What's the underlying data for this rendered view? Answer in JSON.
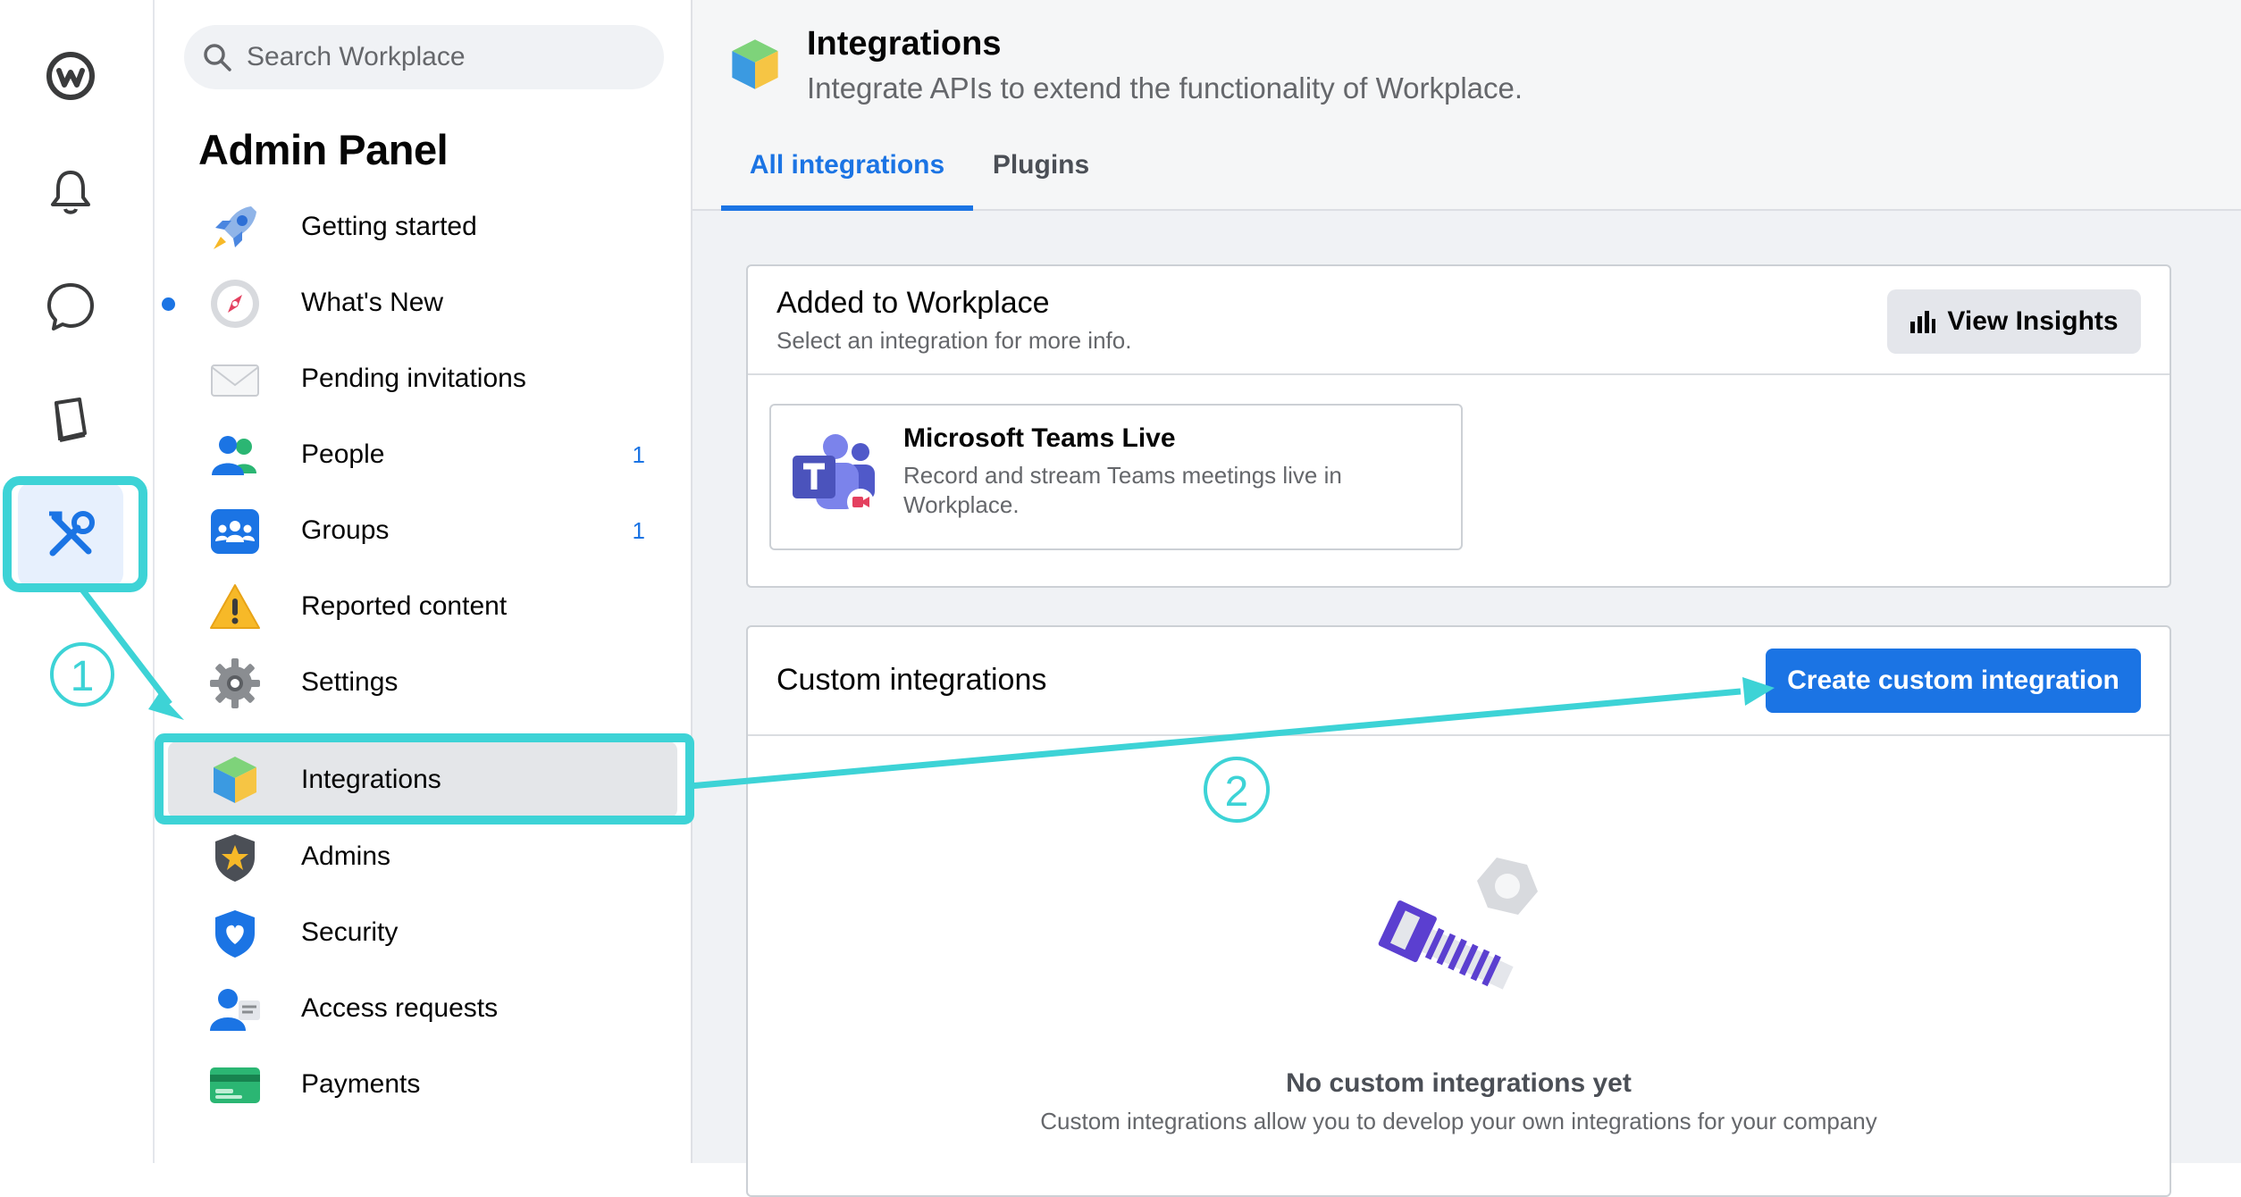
{
  "rail": {
    "items": [
      {
        "icon": "workplace-logo-icon"
      },
      {
        "icon": "bell-icon"
      },
      {
        "icon": "chat-bubble-icon"
      },
      {
        "icon": "book-icon"
      },
      {
        "icon": "tools-icon",
        "active": true
      }
    ]
  },
  "sidebar": {
    "search_placeholder": "Search Workplace",
    "title": "Admin Panel",
    "items": [
      {
        "label": "Getting started",
        "icon": "rocket-icon",
        "count": ""
      },
      {
        "label": "What's New",
        "icon": "compass-icon",
        "count": "",
        "unread_dot": true
      },
      {
        "label": "Pending invitations",
        "icon": "envelope-icon",
        "count": ""
      },
      {
        "label": "People",
        "icon": "people-icon",
        "count": "1"
      },
      {
        "label": "Groups",
        "icon": "groups-icon",
        "count": "1"
      },
      {
        "label": "Reported content",
        "icon": "warning-icon",
        "count": ""
      },
      {
        "label": "Settings",
        "icon": "gear-icon",
        "count": ""
      },
      {
        "label": "Integrations",
        "icon": "cube-icon",
        "count": "",
        "active": true
      },
      {
        "label": "Admins",
        "icon": "shield-star-icon",
        "count": ""
      },
      {
        "label": "Security",
        "icon": "shield-heart-icon",
        "count": ""
      },
      {
        "label": "Access requests",
        "icon": "person-request-icon",
        "count": ""
      },
      {
        "label": "Payments",
        "icon": "credit-card-icon",
        "count": ""
      }
    ]
  },
  "header": {
    "title": "Integrations",
    "subtitle": "Integrate APIs to extend the functionality of Workplace.",
    "tabs": [
      {
        "label": "All integrations",
        "active": true
      },
      {
        "label": "Plugins",
        "active": false
      }
    ]
  },
  "added": {
    "title": "Added to Workplace",
    "subtitle": "Select an integration for more info.",
    "view_insights_label": "View Insights",
    "integrations": [
      {
        "name": "Microsoft Teams Live",
        "description": "Record and stream Teams meetings live in Workplace."
      }
    ]
  },
  "custom": {
    "title": "Custom integrations",
    "create_label": "Create custom integration",
    "empty_title": "No custom integrations yet",
    "empty_desc": "Custom integrations allow you to develop your own integrations for your company"
  },
  "annotations": {
    "step1": "1",
    "step2": "2",
    "color": "#3dd3d6"
  },
  "colors": {
    "accent": "#1b74e4",
    "annotation": "#3dd3d6"
  }
}
